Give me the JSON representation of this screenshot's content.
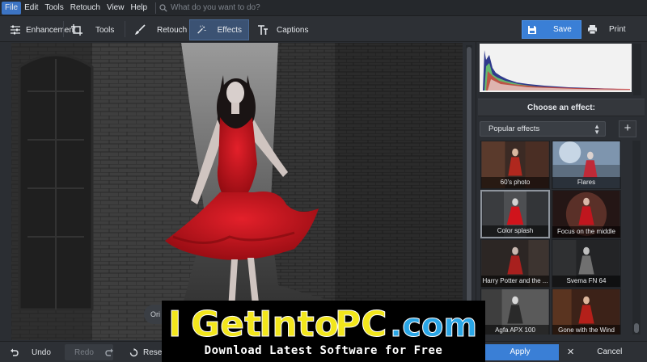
{
  "menu": {
    "items": [
      "File",
      "Edit",
      "Tools",
      "Retouch",
      "View",
      "Help"
    ],
    "search_placeholder": "What do you want to do?"
  },
  "toolbar": {
    "tabs": [
      {
        "label": "Enhancement",
        "icon": "sliders-icon"
      },
      {
        "label": "Tools",
        "icon": "crop-icon"
      },
      {
        "label": "Retouch",
        "icon": "brush-icon"
      },
      {
        "label": "Effects",
        "icon": "magic-wand-icon"
      },
      {
        "label": "Captions",
        "icon": "text-icon"
      }
    ],
    "active_tab": "Effects",
    "save_label": "Save",
    "print_label": "Print"
  },
  "viewer": {
    "original_label": "Ori"
  },
  "bottom": {
    "undo_label": "Undo",
    "redo_label": "Redo",
    "reset_label": "Reset"
  },
  "effects_panel": {
    "title": "Choose an effect:",
    "category": "Popular effects",
    "add_label": "+",
    "effects": [
      {
        "label": "60's photo",
        "tone": "#6a3a2a"
      },
      {
        "label": "Flares",
        "tone": "#9fb1c4"
      },
      {
        "label": "Color splash",
        "tone": "#55585c",
        "selected": true
      },
      {
        "label": "Focus on the middle",
        "tone": "#4a2a24"
      },
      {
        "label": "Harry Potter and the ...",
        "tone": "#3a3230"
      },
      {
        "label": "Svema FN 64",
        "tone": "#2c2d2f"
      },
      {
        "label": "Agfa APX 100",
        "tone": "#5c5c5c"
      },
      {
        "label": "Gone with the Wind",
        "tone": "#5a2f22"
      }
    ],
    "apply_label": "Apply",
    "cancel_label": "Cancel"
  },
  "watermark": {
    "logo_parts": [
      "I",
      "Get",
      "Into",
      "PC",
      ".com"
    ],
    "subtitle": "Download Latest Software for Free"
  },
  "colors": {
    "accent": "#3a7fd6",
    "dress_red": "#c8141c",
    "logo_yellow": "#f2e61c",
    "logo_blue": "#2aa6e6"
  }
}
